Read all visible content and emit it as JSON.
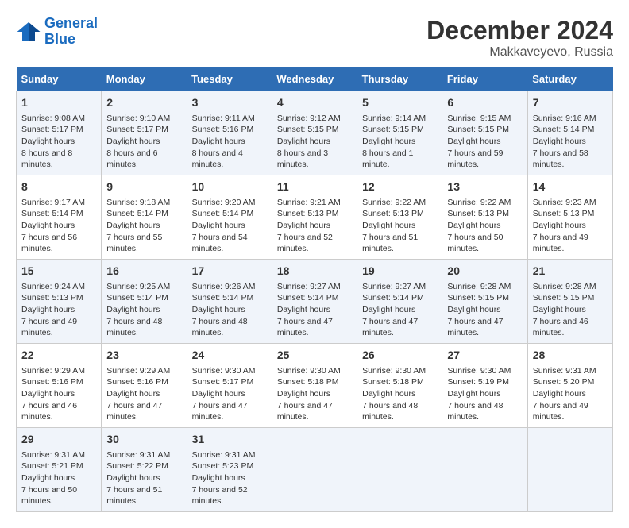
{
  "header": {
    "logo_line1": "General",
    "logo_line2": "Blue",
    "month": "December 2024",
    "location": "Makkaveyevo, Russia"
  },
  "weekdays": [
    "Sunday",
    "Monday",
    "Tuesday",
    "Wednesday",
    "Thursday",
    "Friday",
    "Saturday"
  ],
  "weeks": [
    [
      {
        "day": 1,
        "sunrise": "9:08 AM",
        "sunset": "5:17 PM",
        "daylight": "8 hours and 8 minutes."
      },
      {
        "day": 2,
        "sunrise": "9:10 AM",
        "sunset": "5:17 PM",
        "daylight": "8 hours and 6 minutes."
      },
      {
        "day": 3,
        "sunrise": "9:11 AM",
        "sunset": "5:16 PM",
        "daylight": "8 hours and 4 minutes."
      },
      {
        "day": 4,
        "sunrise": "9:12 AM",
        "sunset": "5:15 PM",
        "daylight": "8 hours and 3 minutes."
      },
      {
        "day": 5,
        "sunrise": "9:14 AM",
        "sunset": "5:15 PM",
        "daylight": "8 hours and 1 minute."
      },
      {
        "day": 6,
        "sunrise": "9:15 AM",
        "sunset": "5:15 PM",
        "daylight": "7 hours and 59 minutes."
      },
      {
        "day": 7,
        "sunrise": "9:16 AM",
        "sunset": "5:14 PM",
        "daylight": "7 hours and 58 minutes."
      }
    ],
    [
      {
        "day": 8,
        "sunrise": "9:17 AM",
        "sunset": "5:14 PM",
        "daylight": "7 hours and 56 minutes."
      },
      {
        "day": 9,
        "sunrise": "9:18 AM",
        "sunset": "5:14 PM",
        "daylight": "7 hours and 55 minutes."
      },
      {
        "day": 10,
        "sunrise": "9:20 AM",
        "sunset": "5:14 PM",
        "daylight": "7 hours and 54 minutes."
      },
      {
        "day": 11,
        "sunrise": "9:21 AM",
        "sunset": "5:13 PM",
        "daylight": "7 hours and 52 minutes."
      },
      {
        "day": 12,
        "sunrise": "9:22 AM",
        "sunset": "5:13 PM",
        "daylight": "7 hours and 51 minutes."
      },
      {
        "day": 13,
        "sunrise": "9:22 AM",
        "sunset": "5:13 PM",
        "daylight": "7 hours and 50 minutes."
      },
      {
        "day": 14,
        "sunrise": "9:23 AM",
        "sunset": "5:13 PM",
        "daylight": "7 hours and 49 minutes."
      }
    ],
    [
      {
        "day": 15,
        "sunrise": "9:24 AM",
        "sunset": "5:13 PM",
        "daylight": "7 hours and 49 minutes."
      },
      {
        "day": 16,
        "sunrise": "9:25 AM",
        "sunset": "5:14 PM",
        "daylight": "7 hours and 48 minutes."
      },
      {
        "day": 17,
        "sunrise": "9:26 AM",
        "sunset": "5:14 PM",
        "daylight": "7 hours and 48 minutes."
      },
      {
        "day": 18,
        "sunrise": "9:27 AM",
        "sunset": "5:14 PM",
        "daylight": "7 hours and 47 minutes."
      },
      {
        "day": 19,
        "sunrise": "9:27 AM",
        "sunset": "5:14 PM",
        "daylight": "7 hours and 47 minutes."
      },
      {
        "day": 20,
        "sunrise": "9:28 AM",
        "sunset": "5:15 PM",
        "daylight": "7 hours and 47 minutes."
      },
      {
        "day": 21,
        "sunrise": "9:28 AM",
        "sunset": "5:15 PM",
        "daylight": "7 hours and 46 minutes."
      }
    ],
    [
      {
        "day": 22,
        "sunrise": "9:29 AM",
        "sunset": "5:16 PM",
        "daylight": "7 hours and 46 minutes."
      },
      {
        "day": 23,
        "sunrise": "9:29 AM",
        "sunset": "5:16 PM",
        "daylight": "7 hours and 47 minutes."
      },
      {
        "day": 24,
        "sunrise": "9:30 AM",
        "sunset": "5:17 PM",
        "daylight": "7 hours and 47 minutes."
      },
      {
        "day": 25,
        "sunrise": "9:30 AM",
        "sunset": "5:18 PM",
        "daylight": "7 hours and 47 minutes."
      },
      {
        "day": 26,
        "sunrise": "9:30 AM",
        "sunset": "5:18 PM",
        "daylight": "7 hours and 48 minutes."
      },
      {
        "day": 27,
        "sunrise": "9:30 AM",
        "sunset": "5:19 PM",
        "daylight": "7 hours and 48 minutes."
      },
      {
        "day": 28,
        "sunrise": "9:31 AM",
        "sunset": "5:20 PM",
        "daylight": "7 hours and 49 minutes."
      }
    ],
    [
      {
        "day": 29,
        "sunrise": "9:31 AM",
        "sunset": "5:21 PM",
        "daylight": "7 hours and 50 minutes."
      },
      {
        "day": 30,
        "sunrise": "9:31 AM",
        "sunset": "5:22 PM",
        "daylight": "7 hours and 51 minutes."
      },
      {
        "day": 31,
        "sunrise": "9:31 AM",
        "sunset": "5:23 PM",
        "daylight": "7 hours and 52 minutes."
      },
      null,
      null,
      null,
      null
    ]
  ]
}
